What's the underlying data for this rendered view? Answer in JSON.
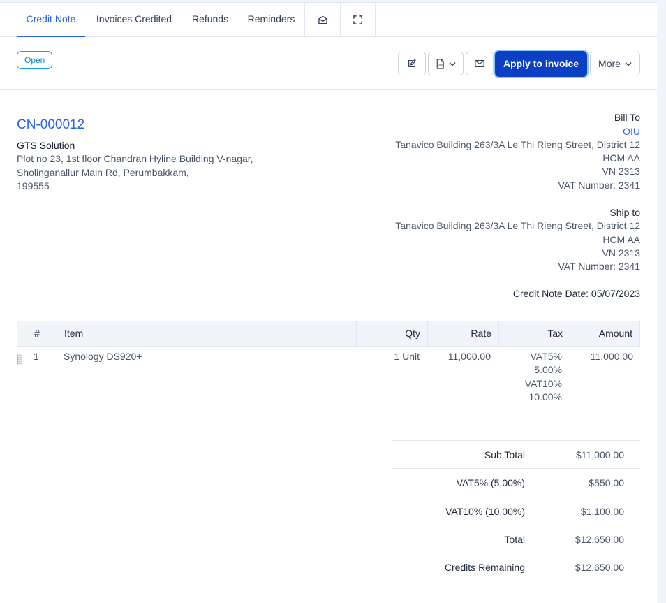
{
  "tabs": [
    {
      "label": "Credit Note"
    },
    {
      "label": "Invoices Credited"
    },
    {
      "label": "Refunds"
    },
    {
      "label": "Reminders"
    }
  ],
  "tab_icons": {
    "mail": "mail-open-icon",
    "fullscreen": "fullscreen-icon"
  },
  "toolbar": {
    "status": "Open",
    "edit_icon": "edit-icon",
    "pdf_icon": "pdf-icon",
    "email_icon": "email-icon",
    "apply_label": "Apply to invoice",
    "more_label": "More"
  },
  "header": {
    "number": "CN-000012",
    "company": "GTS Solution",
    "address_lines": [
      "Plot no 23, 1st floor Chandran Hyline Building V-nagar,",
      "Sholinganallur Main Rd, Perumbakkam,",
      "199555"
    ],
    "bill_to_label": "Bill To",
    "bill_to_name": "OIU",
    "bill_to_lines": [
      "Tanavico Building 263/3A Le Thi Rieng Street, District 12",
      "HCM AA",
      "VN 2313",
      "VAT Number: 2341"
    ],
    "ship_to_label": "Ship to",
    "ship_to_lines": [
      "Tanavico Building 263/3A Le Thi Rieng Street, District 12",
      "HCM AA",
      "VN 2313",
      "VAT Number: 2341"
    ],
    "date_label": "Credit Note Date:",
    "date_value": "05/07/2023"
  },
  "items_table": {
    "columns": [
      "#",
      "Item",
      "Qty",
      "Rate",
      "Tax",
      "Amount"
    ],
    "rows": [
      {
        "num": "1",
        "item": "Synology DS920+",
        "qty": "1 Unit",
        "rate": "11,000.00",
        "tax_lines": [
          "VAT5%",
          "5.00%",
          "VAT10%",
          "10.00%"
        ],
        "amount": "11,000.00"
      }
    ]
  },
  "totals": [
    {
      "label": "Sub Total",
      "value": "$11,000.00"
    },
    {
      "label": "VAT5% (5.00%)",
      "value": "$550.00"
    },
    {
      "label": "VAT10% (10.00%)",
      "value": "$1,100.00"
    },
    {
      "label": "Total",
      "value": "$12,650.00"
    },
    {
      "label": "Credits Remaining",
      "value": "$12,650.00"
    }
  ],
  "colors": {
    "accent": "#2563eb",
    "primary_button": "#0b3fc4",
    "badge": "#0ea5e9"
  }
}
